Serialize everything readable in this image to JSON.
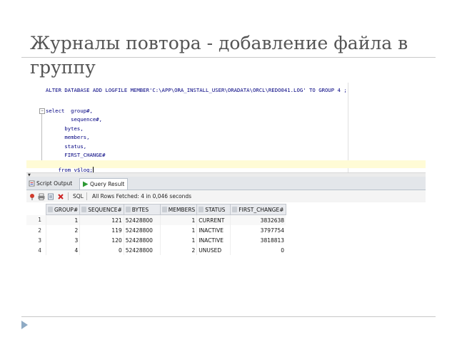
{
  "slide": {
    "title_line1": "Журналы повтора - добавление файла в",
    "title_line2": "группу"
  },
  "editor": {
    "lines": [
      "ALTER DATABASE ADD LOGFILE MEMBER'C:\\APP\\ORA_INSTALL_USER\\ORADATA\\ORCL\\REDO041.LOG' TO GROUP 4 ;",
      "select  group#,",
      "        sequence#,",
      "      bytes,",
      "      members,",
      "      status,",
      "      FIRST_CHANGE#",
      "from v$log;"
    ]
  },
  "tabs": [
    {
      "label": "Script Output",
      "icon": "script-icon"
    },
    {
      "label": "Query Result",
      "icon": "play-icon"
    }
  ],
  "toolbar": {
    "sql_label": "SQL",
    "status": "All Rows Fetched: 4 in 0,046 seconds"
  },
  "grid": {
    "columns": [
      "GROUP#",
      "SEQUENCE#",
      "BYTES",
      "MEMBERS",
      "STATUS",
      "FIRST_CHANGE#"
    ],
    "rows": [
      {
        "n": "1",
        "cells": [
          "1",
          "121",
          "52428800",
          "1",
          "CURRENT",
          "3832638"
        ]
      },
      {
        "n": "2",
        "cells": [
          "2",
          "119",
          "52428800",
          "1",
          "INACTIVE",
          "3797754"
        ]
      },
      {
        "n": "3",
        "cells": [
          "3",
          "120",
          "52428800",
          "1",
          "INACTIVE",
          "3818813"
        ]
      },
      {
        "n": "4",
        "cells": [
          "4",
          "0",
          "52428800",
          "2",
          "UNUSED",
          "0"
        ]
      }
    ]
  },
  "colors": {
    "sql_text": "#000080",
    "highlight_line": "#fffbd6",
    "bullet": "#8eaac4"
  }
}
